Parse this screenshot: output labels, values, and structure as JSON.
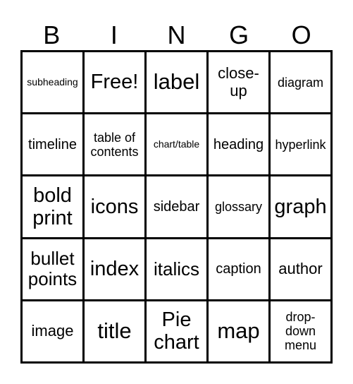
{
  "header": [
    "B",
    "I",
    "N",
    "G",
    "O"
  ],
  "rows": [
    [
      "subheading",
      "Free!",
      "label",
      "close-up",
      "diagram"
    ],
    [
      "timeline",
      "table of contents",
      "chart/table",
      "heading",
      "hyperlink"
    ],
    [
      "bold print",
      "icons",
      "sidebar",
      "glossary",
      "graph"
    ],
    [
      "bullet points",
      "index",
      "italics",
      "caption",
      "author"
    ],
    [
      "image",
      "title",
      "Pie chart",
      "map",
      "drop-down menu"
    ]
  ]
}
